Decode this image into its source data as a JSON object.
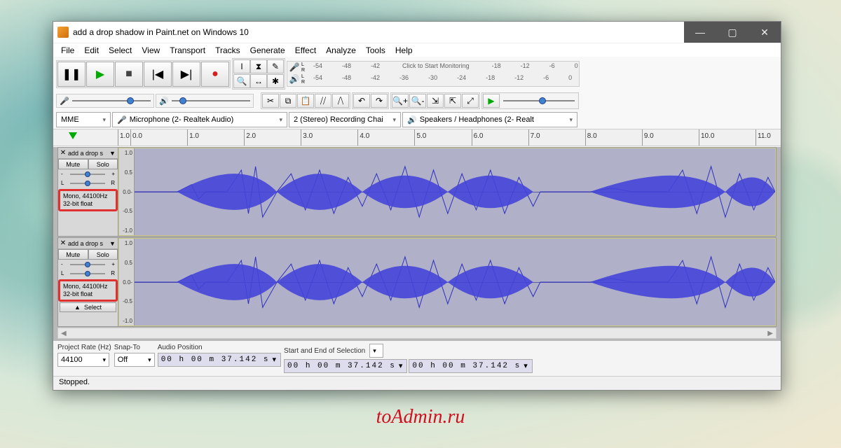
{
  "titlebar": {
    "title": "add a drop shadow in Paint.net on Windows 10"
  },
  "menu": {
    "file": "File",
    "edit": "Edit",
    "select": "Select",
    "view": "View",
    "transport": "Transport",
    "tracks": "Tracks",
    "generate": "Generate",
    "effect": "Effect",
    "analyze": "Analyze",
    "tools": "Tools",
    "help": "Help"
  },
  "meters": {
    "rec_hint": "Click to Start Monitoring",
    "marks": [
      "-54",
      "-48",
      "-42",
      "-36",
      "-30",
      "-24",
      "-18",
      "-12",
      "-6",
      "0"
    ],
    "rec_marks": [
      "-54",
      "-48",
      "-42",
      "-18",
      "-12",
      "-6",
      "0"
    ]
  },
  "devices": {
    "host": "MME",
    "input": "Microphone (2- Realtek Audio)",
    "channels": "2 (Stereo) Recording Chai",
    "output": "Speakers / Headphones (2- Realt"
  },
  "ruler": {
    "marks": [
      "1.0",
      "0.0",
      "1.0",
      "2.0",
      "3.0",
      "4.0",
      "5.0",
      "6.0",
      "7.0",
      "8.0",
      "9.0",
      "10.0",
      "11.0"
    ]
  },
  "track": {
    "name": "add a drop s",
    "mute": "Mute",
    "solo": "Solo",
    "pan_l": "L",
    "pan_r": "R",
    "gain_minus": "-",
    "gain_plus": "+",
    "info_line1": "Mono, 44100Hz",
    "info_line2": "32-bit float",
    "select": "Select"
  },
  "amp": {
    "p10": "1.0",
    "p05": "0.5",
    "zero": "0.0-",
    "m05": "-0.5",
    "m10": "-1.0"
  },
  "selection": {
    "project_rate_label": "Project Rate (Hz)",
    "project_rate": "44100",
    "snap_label": "Snap-To",
    "snap": "Off",
    "audio_pos_label": "Audio Position",
    "audio_pos": "00 h 00 m 37.142 s",
    "sel_label": "Start and End of Selection",
    "sel_start": "00 h 00 m 37.142 s",
    "sel_end": "00 h 00 m 37.142 s"
  },
  "status": {
    "text": "Stopped."
  },
  "watermark": "toAdmin.ru"
}
